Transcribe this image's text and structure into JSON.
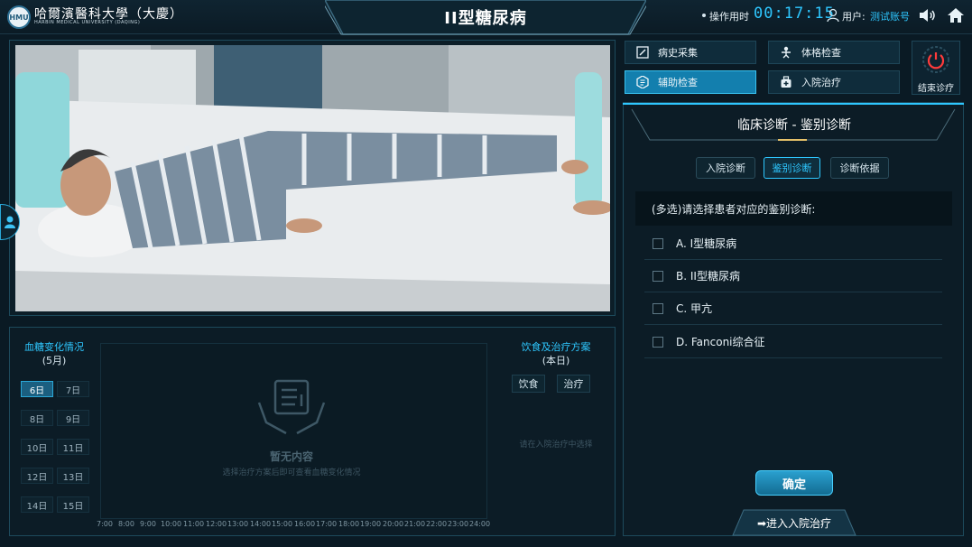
{
  "header": {
    "logo_cn": "哈爾濱醫科大學（大慶）",
    "logo_en": "HARBIN MEDICAL UNIVERSITY (DAQING)",
    "title": "II型糖尿病",
    "op_label": "操作用时",
    "op_time": "00:17:15",
    "user_label": "用户:",
    "user_name": "测试账号"
  },
  "menu": {
    "history": "病史采集",
    "physical": "体格检查",
    "aux": "辅助检查",
    "admit": "入院治疗",
    "end": "结束诊疗"
  },
  "diagnosis": {
    "section_title": "临床诊断 - 鉴别诊断",
    "tabs": [
      "入院诊断",
      "鉴别诊断",
      "诊断依据"
    ],
    "active_tab": "鉴别诊断",
    "question": "(多选)请选择患者对应的鉴别诊断:",
    "options": [
      "A. I型糖尿病",
      "B. II型糖尿病",
      "C. 甲亢",
      "D. Fanconi综合征"
    ],
    "confirm": "确定",
    "enter": "➡进入入院治疗"
  },
  "blood_sugar": {
    "title": "血糖变化情况",
    "month": "(5月)",
    "days": [
      "6日",
      "7日",
      "8日",
      "9日",
      "10日",
      "11日",
      "12日",
      "13日",
      "14日",
      "15日"
    ],
    "selected_day": "6日",
    "empty_title": "暂无内容",
    "empty_sub": "选择治疗方案后即可查看血糖变化情况",
    "hours": [
      "7:00",
      "8:00",
      "9:00",
      "10:00",
      "11:00",
      "12:00",
      "13:00",
      "14:00",
      "15:00",
      "16:00",
      "17:00",
      "18:00",
      "19:00",
      "20:00",
      "21:00",
      "22:00",
      "23:00",
      "24:00"
    ]
  },
  "diet": {
    "title": "饮食及治疗方案",
    "sub": "(本日)",
    "diet_btn": "饮食",
    "treat_btn": "治疗",
    "hint": "请在入院治疗中选择"
  },
  "colors": {
    "accent": "#2ec7ff",
    "panel": "#0c1c26",
    "active_button": "#137fae"
  }
}
